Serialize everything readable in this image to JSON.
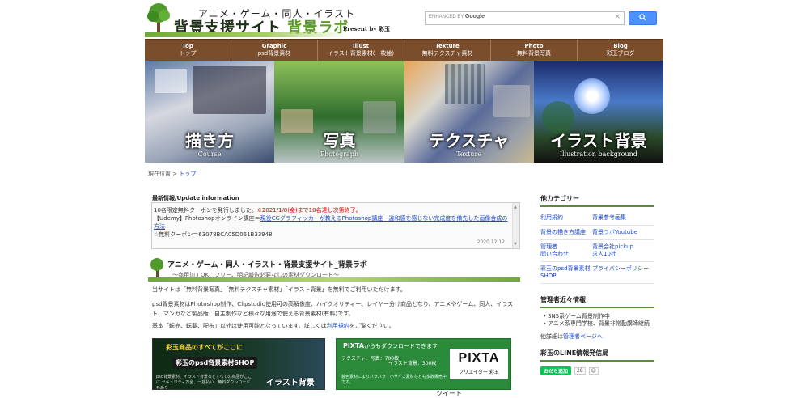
{
  "header": {
    "logo_subtitle": "アニメ・ゲーム・同人・イラスト",
    "logo_title_main": "背景支援サイト",
    "logo_title_accent": "背景ラボ",
    "logo_present": "Present by 彩玉",
    "search_prefix": "ENHANCED BY",
    "search_brand": "Google",
    "search_clear": "×",
    "search_button_icon": "search-icon"
  },
  "nav": [
    {
      "en": "Top",
      "ja": "トップ"
    },
    {
      "en": "Graphic",
      "ja": "psd背景素材"
    },
    {
      "en": "Illust",
      "ja": "イラスト背景素材(一枚絵)"
    },
    {
      "en": "Texture",
      "ja": "無料テクスチャ素材"
    },
    {
      "en": "Photo",
      "ja": "無料背景写真"
    },
    {
      "en": "Blog",
      "ja": "彩玉ブログ"
    }
  ],
  "banner": [
    {
      "ja": "描き方",
      "en": "Course"
    },
    {
      "ja": "写真",
      "en": "Photograph"
    },
    {
      "ja": "テクスチャ",
      "en": "Texture"
    },
    {
      "ja": "イラスト背景",
      "en": "Illustration background"
    }
  ],
  "breadcrumb": {
    "label": "現在位置 > ",
    "current": "トップ"
  },
  "news": {
    "heading": "最新情報/Update information",
    "line1_a": "10名限定無料クーポンを発行しました。",
    "line1_b": "※2021/1/8(金)まで10名達し次第終了。",
    "line2_a": "【Udemy】Photoshopオンライン講座＝",
    "line2_b": "現役CGグラフィッカーが教えるPhotoshop講座　違和感を感じない完成度を備先した画像合成の方法",
    "line3": "☆無料クーポン＝63078BCA05D061B33948",
    "date": "2020.12.12"
  },
  "intro": {
    "title": "アニメ・ゲーム・同人・イラスト・背景支援サイト_背景ラボ",
    "subtitle": "～商用加工OK、フリー、明記報告必要なしの素材ダウンロード～",
    "p1": "当サイトは「無料背景写真」「無料テクスチャ素材」「イラスト背景」を無料でご利用いただけます。",
    "p2": "psd背景素材はPhotoshop制作、Clipstudio使用可の高解像度、ハイクオリティー、レイヤー分け商品となり、アニメやゲーム、同人、イラスト、マンガなど製品版、自主制作など様々な用途で使える背景素材(有料)です。",
    "p3_a": "基本「転売、転載、配布」以外は使用可能となっています。詳しくは",
    "p3_link": "利用規約",
    "p3_b": "をご覧ください。"
  },
  "shop1": {
    "a": "彩玉商品のすべてがここに",
    "b": "彩玉のpsd背景素材SHOP",
    "c": "psd背景素材、イラスト背景などすべての商品がここに セキュリティ万全、一括払い、無料ダウンロードもあり",
    "d": "イラスト背景"
  },
  "shop2": {
    "a_brand": "PIXTA",
    "a_text": "からもダウンロードできます",
    "b_label": "テクスチャ、写真",
    "b_count": "：700枚",
    "b2": "イラスト背景：300枚",
    "c": "着色素材によりバラバラ・小サイズ素材なども多数販売中です。",
    "logo": "PIXTA",
    "logo_sub": "クリエイター 彩玉"
  },
  "sidebar": {
    "cat_heading": "他カテゴリー",
    "cats": [
      "利用規約",
      "背景参考画集",
      "背景の描き方講座",
      "背景ラボYoutube",
      "管理者\n問い合わせ",
      "背景会社pickup\n求人10社",
      "彩玉のpsd背景素材SHOP",
      "プライバシーポリシー"
    ],
    "admin_heading": "管理者近々情報",
    "admin_items": [
      "・SNS系ゲーム背景制作中",
      "・アニメ系専門学校、背景非常勤講師継続"
    ],
    "detail_a": "他詳細は",
    "detail_link": "管理者ページへ",
    "line_heading": "彩玉のLINE情報発信局",
    "line_btn": "おだち追加",
    "line_count": "28",
    "line_share": "☺",
    "tweet": "ツイート"
  }
}
